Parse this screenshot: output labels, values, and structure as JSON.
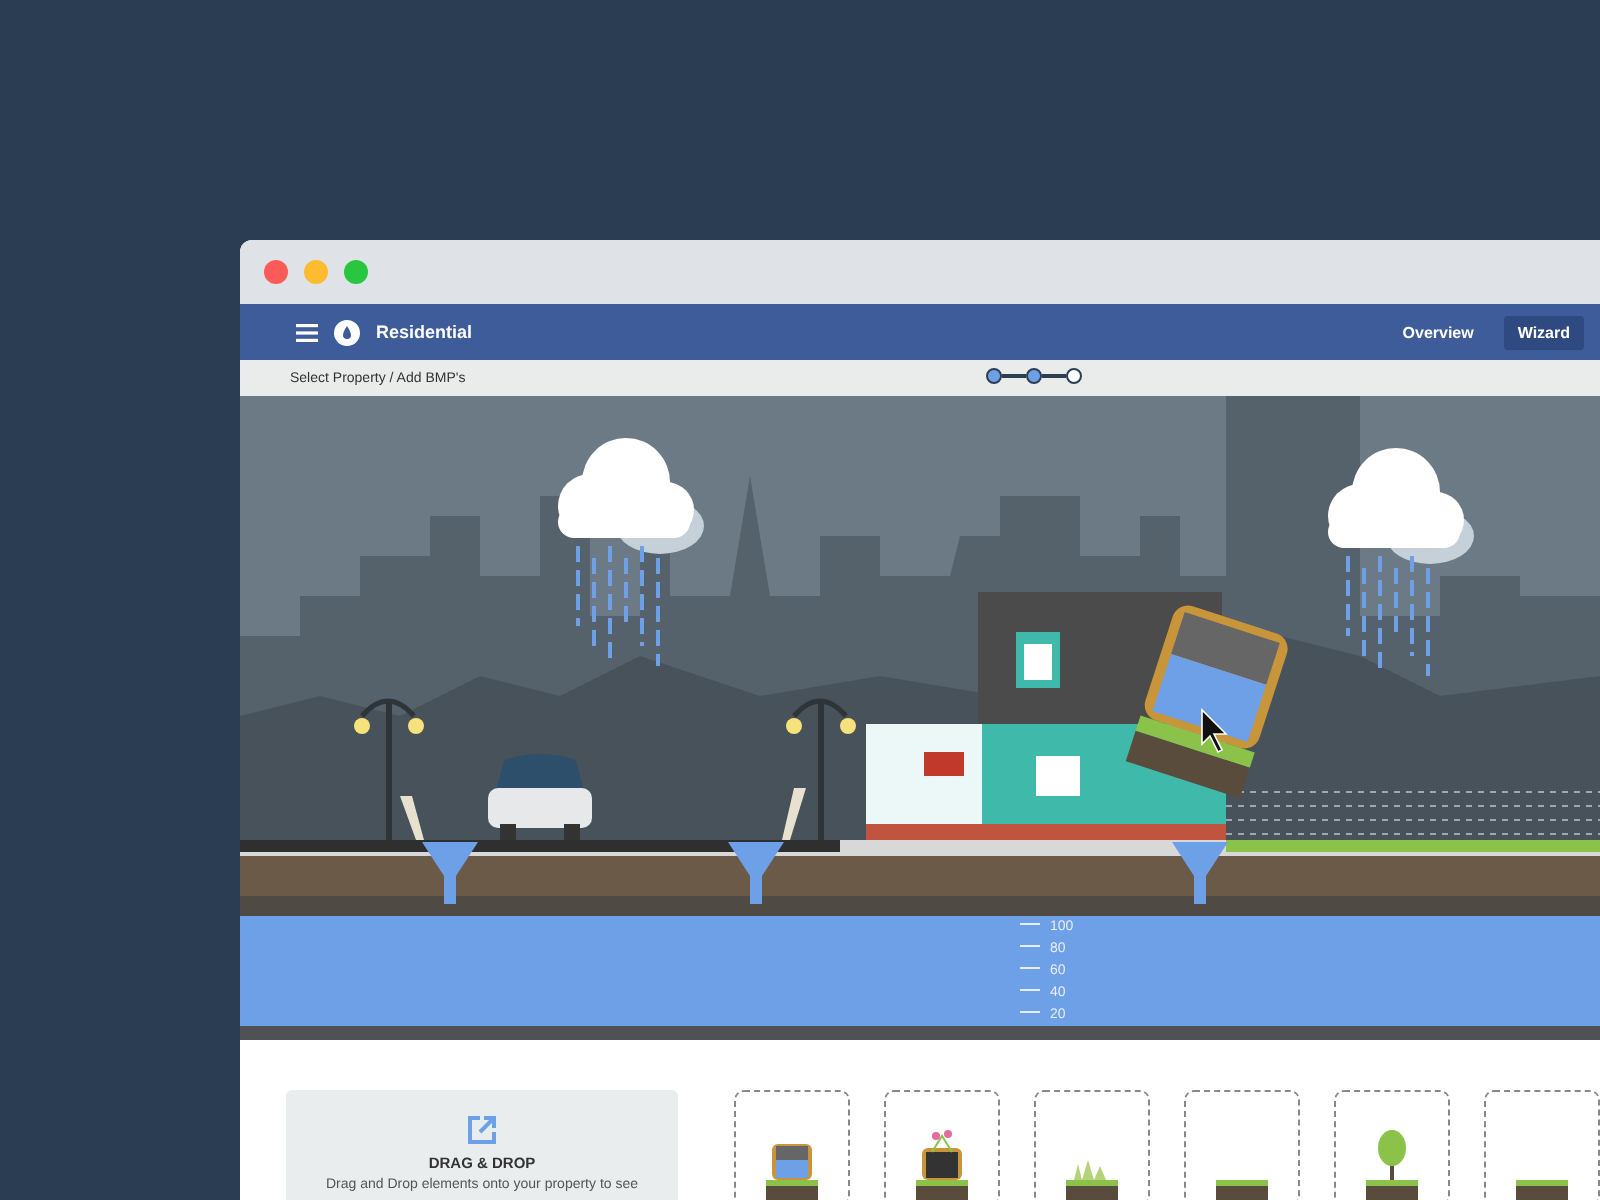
{
  "nav": {
    "title": "Residential",
    "tabs": [
      {
        "label": "Overview",
        "selected": false
      },
      {
        "label": "Wizard",
        "selected": true
      }
    ]
  },
  "breadcrumb": "Select Property / Add BMP's",
  "steps": [
    {
      "done": true
    },
    {
      "done": true
    },
    {
      "done": false
    }
  ],
  "gauge": {
    "ticks": [
      "100",
      "80",
      "60",
      "40",
      "20"
    ]
  },
  "drag_drop": {
    "title": "DRAG & DROP",
    "text": "Drag and Drop elements onto your property to see"
  },
  "elements": [
    {
      "kind": "barrel"
    },
    {
      "kind": "planter"
    },
    {
      "kind": "grass"
    },
    {
      "kind": "pavers"
    },
    {
      "kind": "tree"
    },
    {
      "kind": "soil"
    }
  ]
}
